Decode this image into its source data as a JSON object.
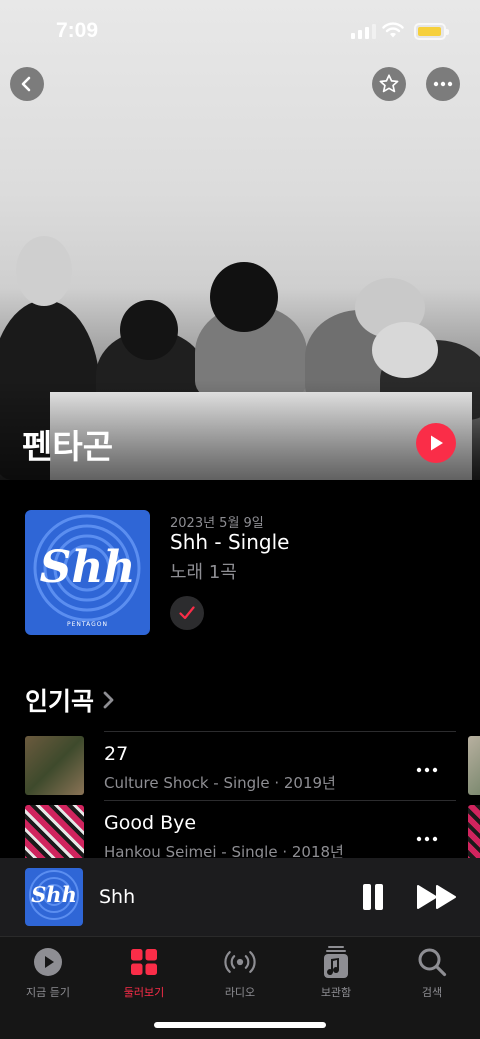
{
  "status_bar": {
    "time": "7:09"
  },
  "header": {
    "back_icon": "chevron-left-icon",
    "favorite_icon": "star-icon",
    "more_icon": "ellipsis-icon"
  },
  "artist": {
    "name": "펜타곤",
    "play_icon": "play-icon",
    "accent": "#fa2d48"
  },
  "latest_release": {
    "date": "2023년 5월 9일",
    "title": "Shh - Single",
    "subtitle": "노래 1곡",
    "artwork_text": "Shh",
    "artwork_label": "PENTAGON",
    "added_icon": "checkmark-icon"
  },
  "top_songs": {
    "title": "인기곡",
    "items": [
      {
        "title": "27",
        "subtitle": "Culture Shock - Single · 2019년"
      },
      {
        "title": "Good Bye",
        "subtitle": "Hankou Seimei - Single · 2018년"
      }
    ]
  },
  "mini_player": {
    "title": "Shh",
    "artwork_text": "Shh"
  },
  "tab_bar": {
    "tabs": [
      {
        "label": "지금 듣기",
        "icon": "play-circle-icon",
        "active": false
      },
      {
        "label": "둘러보기",
        "icon": "grid-icon",
        "active": true
      },
      {
        "label": "라디오",
        "icon": "radio-waves-icon",
        "active": false
      },
      {
        "label": "보관함",
        "icon": "music-library-icon",
        "active": false
      },
      {
        "label": "검색",
        "icon": "search-icon",
        "active": false
      }
    ]
  }
}
